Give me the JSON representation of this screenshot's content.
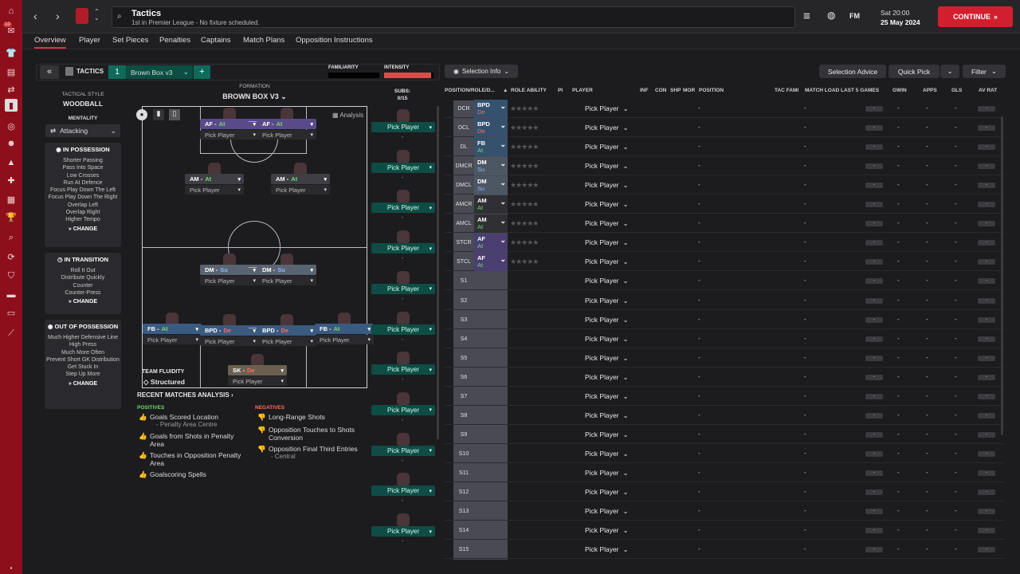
{
  "header": {
    "title": "Tactics",
    "subtitle": "1st in Premier League - No fixture scheduled.",
    "fm": "FM",
    "time": "Sat 20:00",
    "date": "25 May 2024",
    "continue": "CONTINUE",
    "badge": "10"
  },
  "tabs": [
    "Overview",
    "Player",
    "Set Pieces",
    "Penalties",
    "Captains",
    "Match Plans",
    "Opposition Instructions"
  ],
  "tactic": {
    "label": "TACTICS",
    "slot": "1",
    "name": "Brown Box v3",
    "plus": "+",
    "familiarity": "FAMILIARITY",
    "intensity": "INTENSITY",
    "intensity_level": 0.95,
    "familiarity_level": 0.0
  },
  "left": {
    "style_label": "TACTICAL STYLE",
    "style": "WOODBALL",
    "mentality_label": "MENTALITY",
    "mentality": "Attacking",
    "in_possession": {
      "title": "IN POSSESSION",
      "items": [
        "Shorter Passing",
        "Pass Into Space",
        "Low Crosses",
        "Run At Defence",
        "Focus Play Down The Left",
        "Focus Play Down The Right",
        "Overlap Left",
        "Overlap Right",
        "Higher Tempo"
      ]
    },
    "in_transition": {
      "title": "IN TRANSITION",
      "items": [
        "Roll It Out",
        "Distribute Quickly",
        "Counter",
        "Counter-Press"
      ]
    },
    "out_possession": {
      "title": "OUT OF POSSESSION",
      "items": [
        "Much Higher Defensive Line",
        "High Press",
        "Much More Often",
        "Prevent Short GK Distribution",
        "Get Stuck In",
        "Step Up More"
      ]
    },
    "change": "CHANGE"
  },
  "formation": {
    "label": "FORMATION",
    "name": "BROWN BOX V3",
    "analysis": "Analysis",
    "subs_label": "SUBS:",
    "subs_count": "0/15",
    "fluidity_label": "TEAM FLUIDITY",
    "fluidity": "Structured",
    "pick": "Pick Player",
    "dash": "-"
  },
  "players": [
    {
      "role": "AF",
      "duty": "At",
      "cls": "at",
      "color": "#5b4a8a"
    },
    {
      "role": "AF",
      "duty": "At",
      "cls": "at",
      "color": "#5b4a8a"
    },
    {
      "role": "AM",
      "duty": "At",
      "cls": "at",
      "color": "#3e3e44"
    },
    {
      "role": "AM",
      "duty": "At",
      "cls": "at",
      "color": "#3e3e44"
    },
    {
      "role": "DM",
      "duty": "Su",
      "cls": "su",
      "color": "#5a6470"
    },
    {
      "role": "DM",
      "duty": "Su",
      "cls": "su",
      "color": "#5a6470"
    },
    {
      "role": "FB",
      "duty": "At",
      "cls": "at",
      "color": "#3a5a80"
    },
    {
      "role": "BPD",
      "duty": "De",
      "cls": "de",
      "color": "#3a5a80"
    },
    {
      "role": "BPD",
      "duty": "De",
      "cls": "de",
      "color": "#3a5a80"
    },
    {
      "role": "FB",
      "duty": "At",
      "cls": "at",
      "color": "#3a5a80"
    },
    {
      "role": "SK",
      "duty": "De",
      "cls": "de",
      "color": "#6b6050"
    }
  ],
  "analysis": {
    "title": "RECENT MATCHES ANALYSIS",
    "pos_label": "POSITIVES",
    "neg_label": "NEGATIVES",
    "positives": [
      "Goals Scored Location",
      "- Penalty Area Centre",
      "Goals from Shots in Penalty Area",
      "Touches in Opposition Penalty Area",
      "Goalscoring Spells"
    ],
    "negatives": [
      "Long-Range Shots",
      "Opposition Touches to Shots Conversion",
      "Opposition Final Third Entries",
      "- Central"
    ]
  },
  "table": {
    "selection": "Selection Info",
    "advice": "Selection Advice",
    "quick": "Quick Pick",
    "filter": "Filter",
    "headers": [
      "POSITION/ROLE/D...",
      "ROLE ABILITY",
      "PI",
      "PLAYER",
      "INF",
      "CON",
      "SHP",
      "MOR",
      "POSITION",
      "TAC FAMI",
      "MATCH LOAD LAST 5 GAMES",
      "GWIN",
      "APPS",
      "GLS",
      "AV RAT"
    ],
    "rows": [
      {
        "pos": "DCR",
        "role": "BPD",
        "duty": "De",
        "cls": "de",
        "color": "#35516e"
      },
      {
        "pos": "DCL",
        "role": "BPD",
        "duty": "De",
        "cls": "de",
        "color": "#35516e"
      },
      {
        "pos": "DL",
        "role": "FB",
        "duty": "At",
        "cls": "at",
        "color": "#35516e"
      },
      {
        "pos": "DMCR",
        "role": "DM",
        "duty": "Su",
        "cls": "su",
        "color": "#4d5763"
      },
      {
        "pos": "DMCL",
        "role": "DM",
        "duty": "Su",
        "cls": "su",
        "color": "#4d5763"
      },
      {
        "pos": "AMCR",
        "role": "AM",
        "duty": "At",
        "cls": "at",
        "color": "#2f2f34"
      },
      {
        "pos": "AMCL",
        "role": "AM",
        "duty": "At",
        "cls": "at",
        "color": "#2f2f34"
      },
      {
        "pos": "STCR",
        "role": "AF",
        "duty": "At",
        "cls": "at",
        "color": "#4a3f70"
      },
      {
        "pos": "STCL",
        "role": "AF",
        "duty": "At",
        "cls": "at",
        "color": "#4a3f70"
      },
      {
        "pos": "S1"
      },
      {
        "pos": "S2"
      },
      {
        "pos": "S3"
      },
      {
        "pos": "S4"
      },
      {
        "pos": "S5"
      },
      {
        "pos": "S6"
      },
      {
        "pos": "S7"
      },
      {
        "pos": "S8"
      },
      {
        "pos": "S9"
      },
      {
        "pos": "S10"
      },
      {
        "pos": "S11"
      },
      {
        "pos": "S12"
      },
      {
        "pos": "S13"
      },
      {
        "pos": "S14"
      },
      {
        "pos": "S15"
      }
    ]
  }
}
